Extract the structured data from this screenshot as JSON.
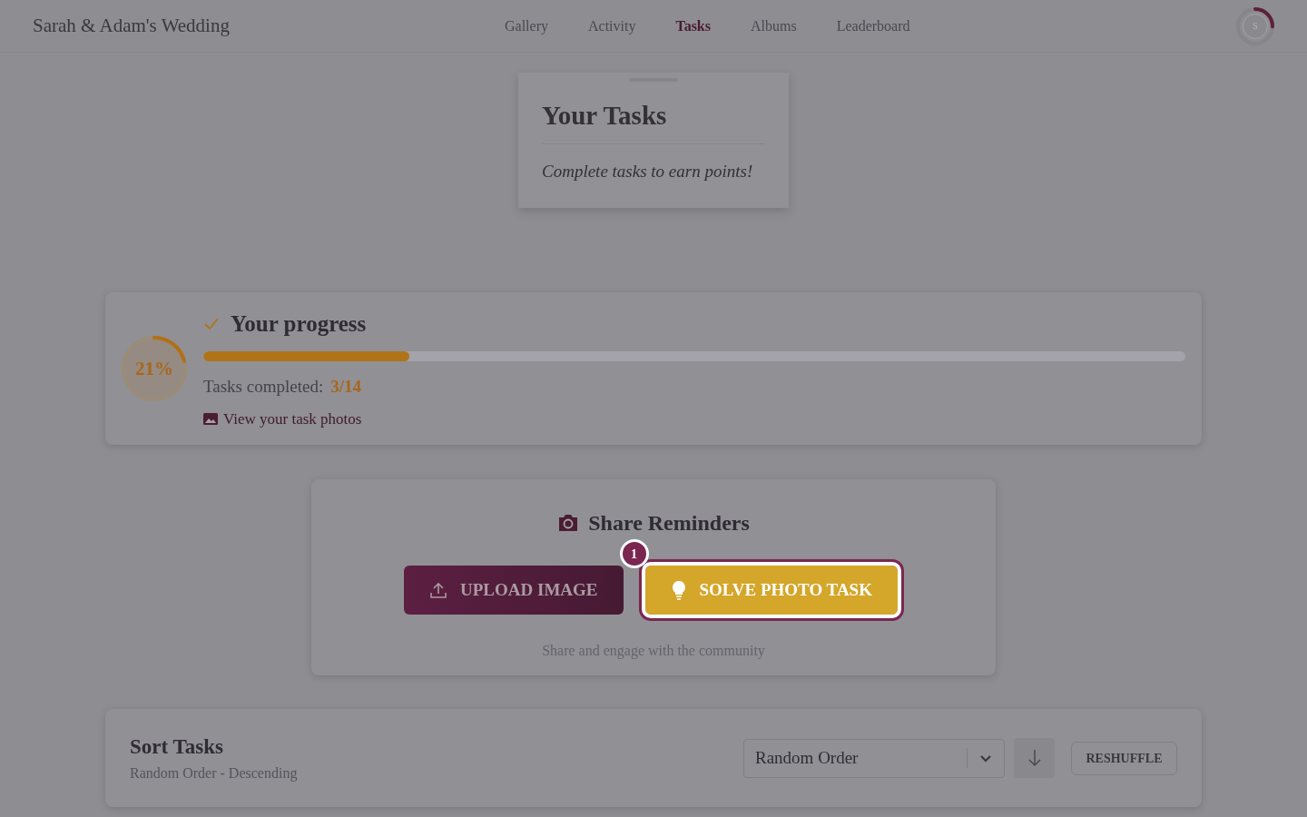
{
  "header": {
    "title": "Sarah & Adam's Wedding",
    "nav": [
      {
        "label": "Gallery",
        "selected": false
      },
      {
        "label": "Activity",
        "selected": false
      },
      {
        "label": "Tasks",
        "selected": true
      },
      {
        "label": "Albums",
        "selected": false
      },
      {
        "label": "Leaderboard",
        "selected": false
      }
    ],
    "avatar": {
      "initial": "S"
    }
  },
  "intro": {
    "title": "Your Tasks",
    "subtitle": "Complete tasks to earn points!"
  },
  "progress": {
    "percent": "21%",
    "level": 0.21,
    "title": "Your progress",
    "completed_label": "Tasks completed:",
    "completed_value": "3/14",
    "photos_link": "View your task photos"
  },
  "share": {
    "title": "Share Reminders",
    "badge": "1",
    "caption": "Share and engage with the community",
    "buttons": [
      {
        "label": "UPLOAD IMAGE",
        "kind": "upload",
        "highlighted": false
      },
      {
        "label": "SOLVE PHOTO TASK",
        "kind": "solve",
        "highlighted": true
      }
    ]
  },
  "sort": {
    "title": "Sort Tasks",
    "subtitle": "Random Order - Descending",
    "select_value": "Random Order",
    "reshuffle": "RESHUFFLE"
  }
}
